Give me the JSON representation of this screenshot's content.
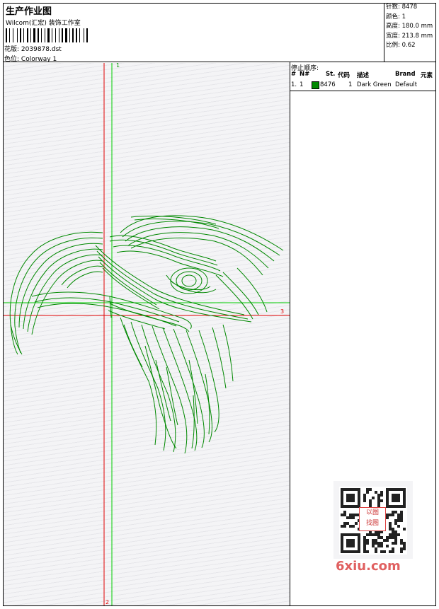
{
  "header": {
    "title": "生产作业图",
    "company": "Wilcom(汇宏) 装饰工作室",
    "design_label": "花版:",
    "design_file": "2039878.dst",
    "colorway_label": "色位:",
    "colorway": "Colorway 1"
  },
  "stats": {
    "stitches_label": "针数:",
    "stitches": "8478",
    "colors_label": "颜色:",
    "colors": "1",
    "height_label": "高度:",
    "height": "180.0 mm",
    "width_label": "宽度:",
    "width": "213.8 mm",
    "ratio_label": "比例:",
    "ratio": "0.62"
  },
  "stop_sequence": {
    "title": "停止顺序:",
    "columns": [
      "#",
      "N#",
      "St.",
      "代码",
      "描述",
      "Brand",
      "元素"
    ],
    "rows": [
      {
        "index": "1.",
        "needle": "1",
        "stitches": "8476",
        "code": "1",
        "description": "Dark Green",
        "brand": "Default",
        "color": "#008800"
      }
    ]
  },
  "axes": {
    "label_1": "1",
    "label_2": "2",
    "label_3": "3"
  },
  "colors": {
    "thread": "#008800",
    "red_axis": "#e00000",
    "green_axis": "#00cc00"
  },
  "qr_logo_text": "以图",
  "qr_logo_text2": "找图",
  "watermark": "6xiu.com"
}
